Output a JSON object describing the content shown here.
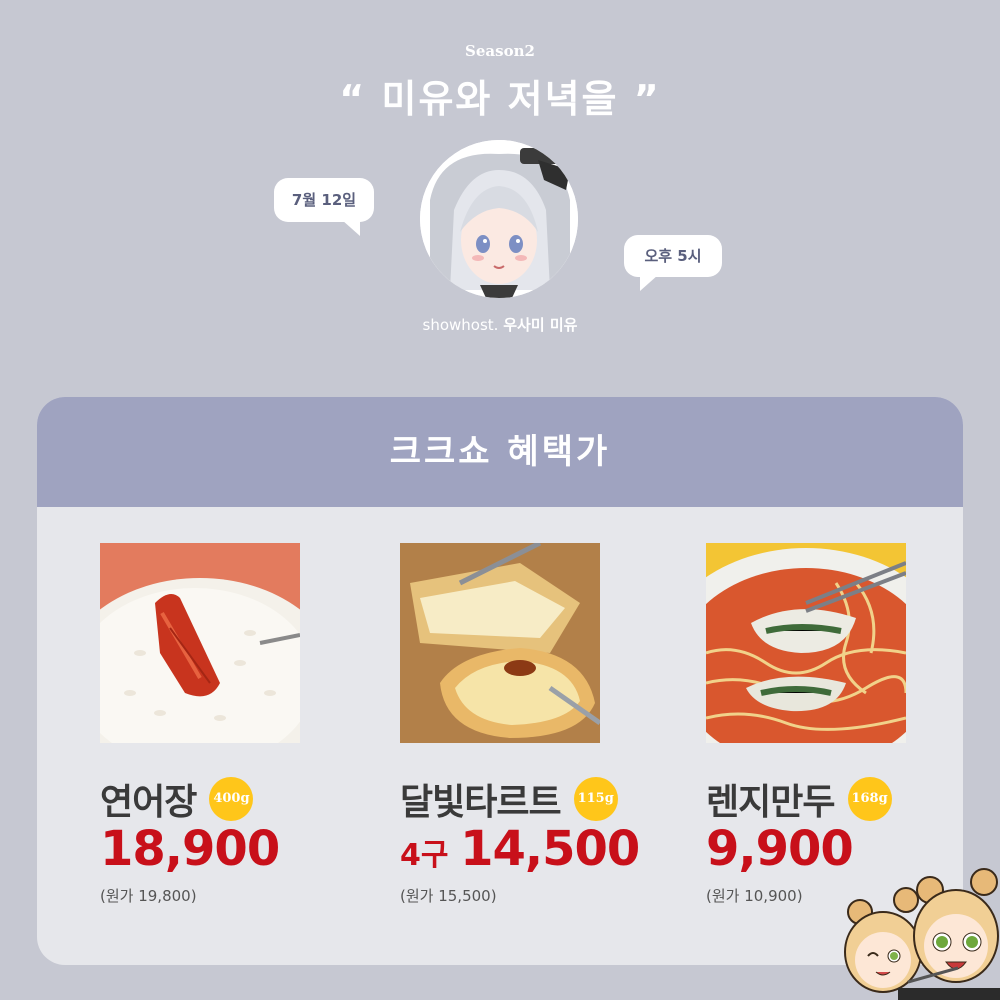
{
  "header": {
    "season": "Season2",
    "title": "“ 미유와 저녁을 ”"
  },
  "bubbles": {
    "date": "7월 12일",
    "time": "오후 5시"
  },
  "host": {
    "prefix": "showhost.",
    "name": "우사미 미유"
  },
  "card": {
    "title": "크크쇼 혜택가",
    "products": [
      {
        "name": "연어장",
        "weight": "400g",
        "prefix": "",
        "price": "18,900",
        "original": "(원가 19,800)"
      },
      {
        "name": "달빛타르트",
        "weight": "115g",
        "prefix": "4구",
        "price": "14,500",
        "original": "(원가 15,500)"
      },
      {
        "name": "렌지만두",
        "weight": "168g",
        "prefix": "",
        "price": "9,900",
        "original": "(원가 10,900)"
      }
    ]
  },
  "colors": {
    "background": "#c6c8d2",
    "card_header": "#9fa3c0",
    "card_body": "#e6e7eb",
    "price": "#c8101a",
    "weight_badge": "#ffc61a"
  }
}
